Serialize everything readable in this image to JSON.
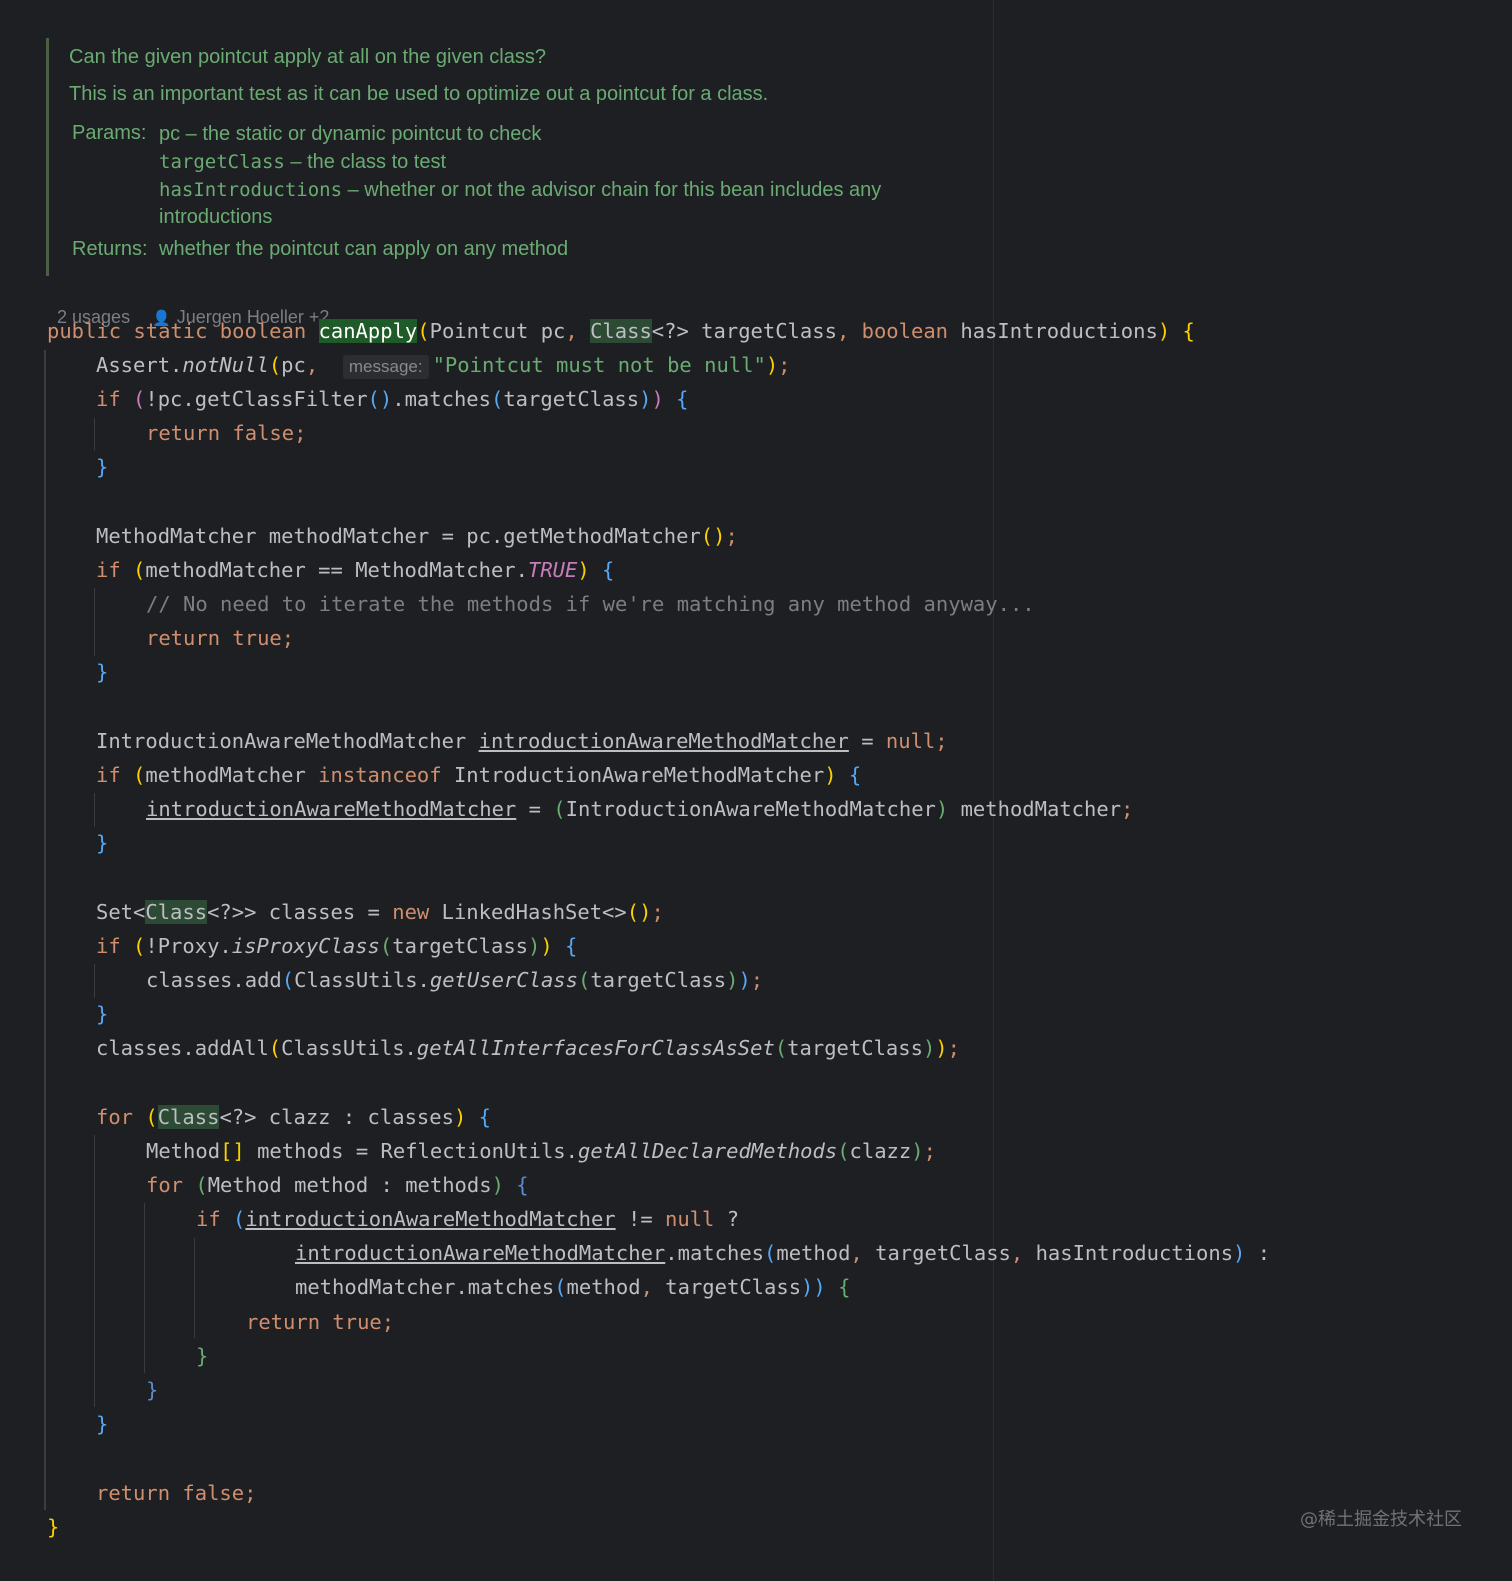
{
  "doc": {
    "summary": "Can the given pointcut apply at all on the given class?",
    "detail": "This is an important test as it can be used to optimize out a pointcut for a class.",
    "params_label": "Params:",
    "param1_name": "pc",
    "param1_desc": " – the static or dynamic pointcut to check",
    "param2_name": "targetClass",
    "param2_desc": " – the class to test",
    "param3_name": "hasIntroductions",
    "param3_desc": " – whether or not the advisor chain for this bean includes any",
    "param3_desc_cont": "introductions",
    "returns_label": "Returns:",
    "returns_desc": "whether the pointcut can apply on any method"
  },
  "meta": {
    "usages": "2 usages",
    "authors": "Juergen Hoeller +2"
  },
  "inlay_hint": "message:",
  "watermark": "@稀土掘金技术社区"
}
